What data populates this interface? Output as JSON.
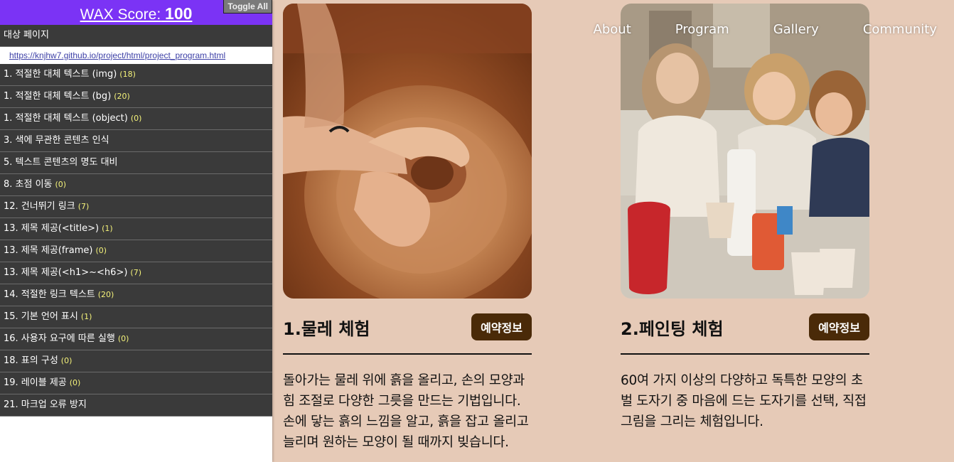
{
  "wax": {
    "score_label": "WAX Score:",
    "score_value": "100",
    "toggle_label": "Toggle All",
    "target_label": "대상 페이지",
    "target_url": "https://knjhw7.github.io/project/html/project_program.html",
    "items": [
      {
        "label": "1. 적절한 대체 텍스트 (img)",
        "count": "(18)"
      },
      {
        "label": "1. 적절한 대체 텍스트 (bg)",
        "count": "(20)"
      },
      {
        "label": "1. 적절한 대체 텍스트 (object)",
        "count": "(0)"
      },
      {
        "label": "3. 색에 무관한 콘텐츠 인식",
        "count": ""
      },
      {
        "label": "5. 텍스트 콘텐츠의 명도 대비",
        "count": ""
      },
      {
        "label": "8. 초점 이동",
        "count": "(0)"
      },
      {
        "label": "12. 건너뛰기 링크",
        "count": "(7)"
      },
      {
        "label": "13. 제목 제공(<title>)",
        "count": "(1)"
      },
      {
        "label": "13. 제목 제공(frame)",
        "count": "(0)"
      },
      {
        "label": "13. 제목 제공(<h1>~<h6>)",
        "count": "(7)"
      },
      {
        "label": "14. 적절한 링크 텍스트",
        "count": "(20)"
      },
      {
        "label": "15. 기본 언어 표시",
        "count": "(1)"
      },
      {
        "label": "16. 사용자 요구에 따른 실행",
        "count": "(0)"
      },
      {
        "label": "18. 표의 구성",
        "count": "(0)"
      },
      {
        "label": "19. 레이블 제공",
        "count": "(0)"
      },
      {
        "label": "21. 마크업 오류 방지",
        "count": ""
      }
    ]
  },
  "nav": {
    "about": "About",
    "program": "Program",
    "gallery": "Gallery",
    "community": "Community"
  },
  "programs": [
    {
      "title": "1.물레 체험",
      "button": "예약정보",
      "description": "돌아가는 물레 위에 흙을 올리고, 손의 모양과 힘 조절로 다양한 그릇을 만드는 기법입니다. 손에 닿는 흙의 느낌을 알고, 흙을 잡고 올리고 늘리며 원하는 모양이 될 때까지 빚습니다."
    },
    {
      "title": "2.페인팅 체험",
      "button": "예약정보",
      "description": "60여 가지 이상의 다양하고 독특한 모양의 초벌 도자기 중 마음에 드는 도자기를 선택, 직접 그림을 그리는 체험입니다."
    }
  ],
  "colors": {
    "page_bg": "#e6cab7",
    "wax_header": "#7b33f5",
    "wax_row": "#3a3a3a",
    "button_bg": "#4a2a08"
  }
}
